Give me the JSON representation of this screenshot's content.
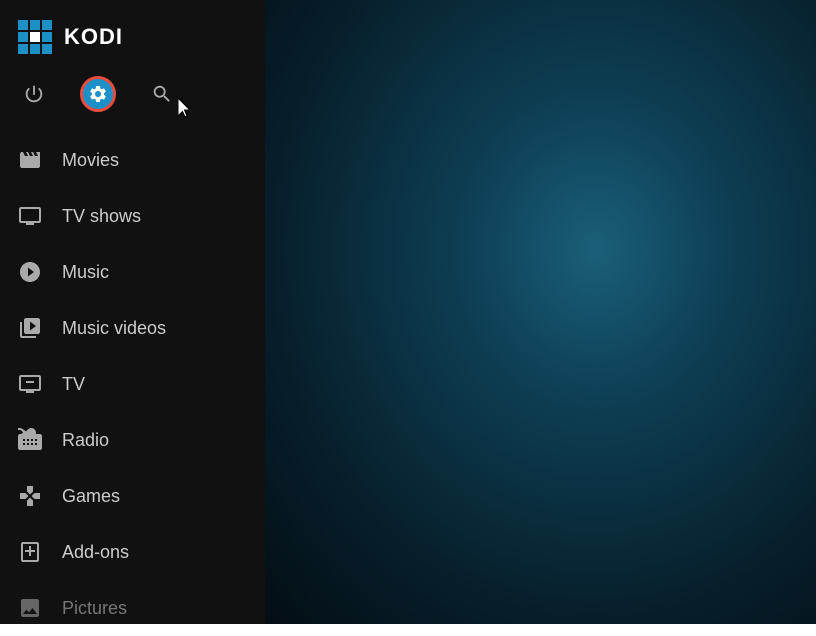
{
  "app": {
    "title": "KODI"
  },
  "topIcons": [
    {
      "name": "power",
      "label": "Power",
      "icon": "power-icon",
      "active": false
    },
    {
      "name": "settings",
      "label": "Settings",
      "icon": "settings-icon",
      "active": true
    },
    {
      "name": "search",
      "label": "Search",
      "icon": "search-icon",
      "active": false
    }
  ],
  "navItems": [
    {
      "id": "movies",
      "label": "Movies",
      "icon": "movies-icon",
      "dimmed": false
    },
    {
      "id": "tv-shows",
      "label": "TV shows",
      "icon": "tv-shows-icon",
      "dimmed": false
    },
    {
      "id": "music",
      "label": "Music",
      "icon": "music-icon",
      "dimmed": false
    },
    {
      "id": "music-videos",
      "label": "Music videos",
      "icon": "music-videos-icon",
      "dimmed": false
    },
    {
      "id": "tv",
      "label": "TV",
      "icon": "tv-icon",
      "dimmed": false
    },
    {
      "id": "radio",
      "label": "Radio",
      "icon": "radio-icon",
      "dimmed": false
    },
    {
      "id": "games",
      "label": "Games",
      "icon": "games-icon",
      "dimmed": false
    },
    {
      "id": "add-ons",
      "label": "Add-ons",
      "icon": "add-ons-icon",
      "dimmed": false
    },
    {
      "id": "pictures",
      "label": "Pictures",
      "icon": "pictures-icon",
      "dimmed": true
    }
  ]
}
